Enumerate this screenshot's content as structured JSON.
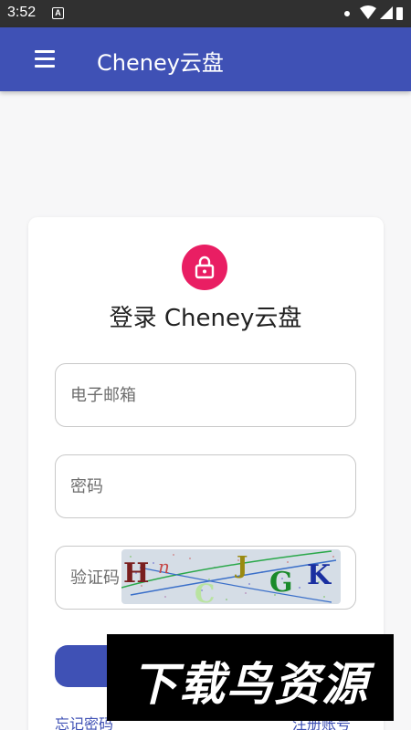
{
  "status_bar": {
    "time": "3:52",
    "notification_letter": "A"
  },
  "app_bar": {
    "title": "Cheney云盘",
    "menu_icon": "hamburger-menu-icon"
  },
  "login": {
    "lock_icon": "lock-icon",
    "accent_color": "#e91e63",
    "title": "登录 Cheney云盘",
    "email_placeholder": "电子邮箱",
    "password_placeholder": "密码",
    "captcha_placeholder": "验证码",
    "captcha_letters": [
      "H",
      "n",
      "C",
      "J",
      "G",
      "K"
    ],
    "forgot_password": "忘记密码",
    "register": "注册账号"
  },
  "colors": {
    "primary": "#3f51b5",
    "status_bar": "#303030"
  },
  "watermark": {
    "text": "下载鸟资源"
  }
}
